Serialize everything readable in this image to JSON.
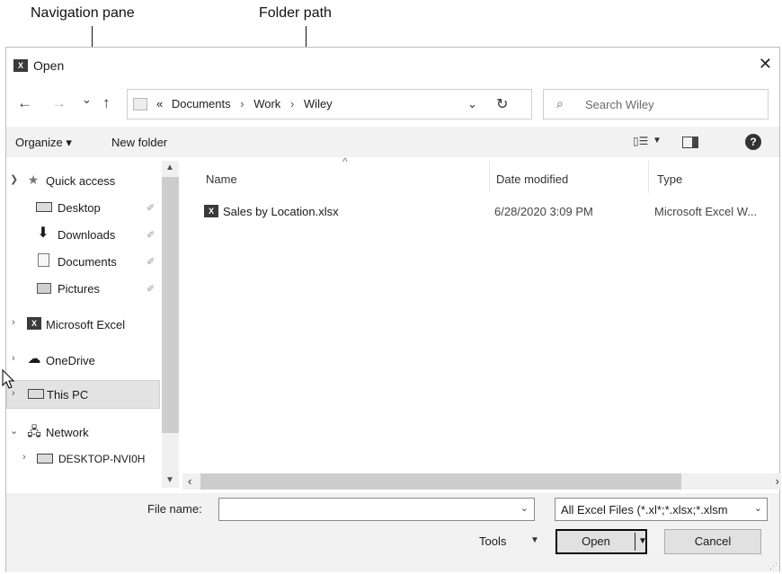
{
  "callouts": {
    "navigation_pane": "Navigation pane",
    "folder_path": "Folder path"
  },
  "window": {
    "app_icon": "X",
    "title": "Open",
    "close": "✕"
  },
  "nav_buttons": {
    "back": "←",
    "forward": "→",
    "recent": "⌄",
    "up": "↑"
  },
  "address": {
    "overflow": "«",
    "crumbs": [
      "Documents",
      "Work",
      "Wiley"
    ],
    "dropdown": "⌄",
    "refresh": "↻"
  },
  "search": {
    "placeholder": "Search Wiley"
  },
  "toolbar": {
    "organize": "Organize ▾",
    "new_folder": "New folder",
    "view_icon": "▯☰",
    "help": "?"
  },
  "navigation": {
    "quick_access": {
      "label": "Quick access",
      "expanded": true
    },
    "pinned": [
      {
        "label": "Desktop",
        "icon": "monitor-icon"
      },
      {
        "label": "Downloads",
        "icon": "download-arrow-icon"
      },
      {
        "label": "Documents",
        "icon": "document-icon"
      },
      {
        "label": "Pictures",
        "icon": "picture-icon"
      }
    ],
    "microsoft_excel": "Microsoft Excel",
    "onedrive": "OneDrive",
    "this_pc": "This PC",
    "network": "Network",
    "desktop_pc": "DESKTOP-NVI0H"
  },
  "columns": {
    "name": "Name",
    "date_modified": "Date modified",
    "type": "Type"
  },
  "files": [
    {
      "name": "Sales by Location.xlsx",
      "date_modified": "6/28/2020 3:09 PM",
      "type": "Microsoft Excel W..."
    }
  ],
  "bottom": {
    "file_name_label": "File name:",
    "file_name_value": "",
    "filter": "All Excel Files (*.xl*;*.xlsx;*.xlsm",
    "tools": "Tools",
    "open": "Open",
    "cancel": "Cancel"
  }
}
